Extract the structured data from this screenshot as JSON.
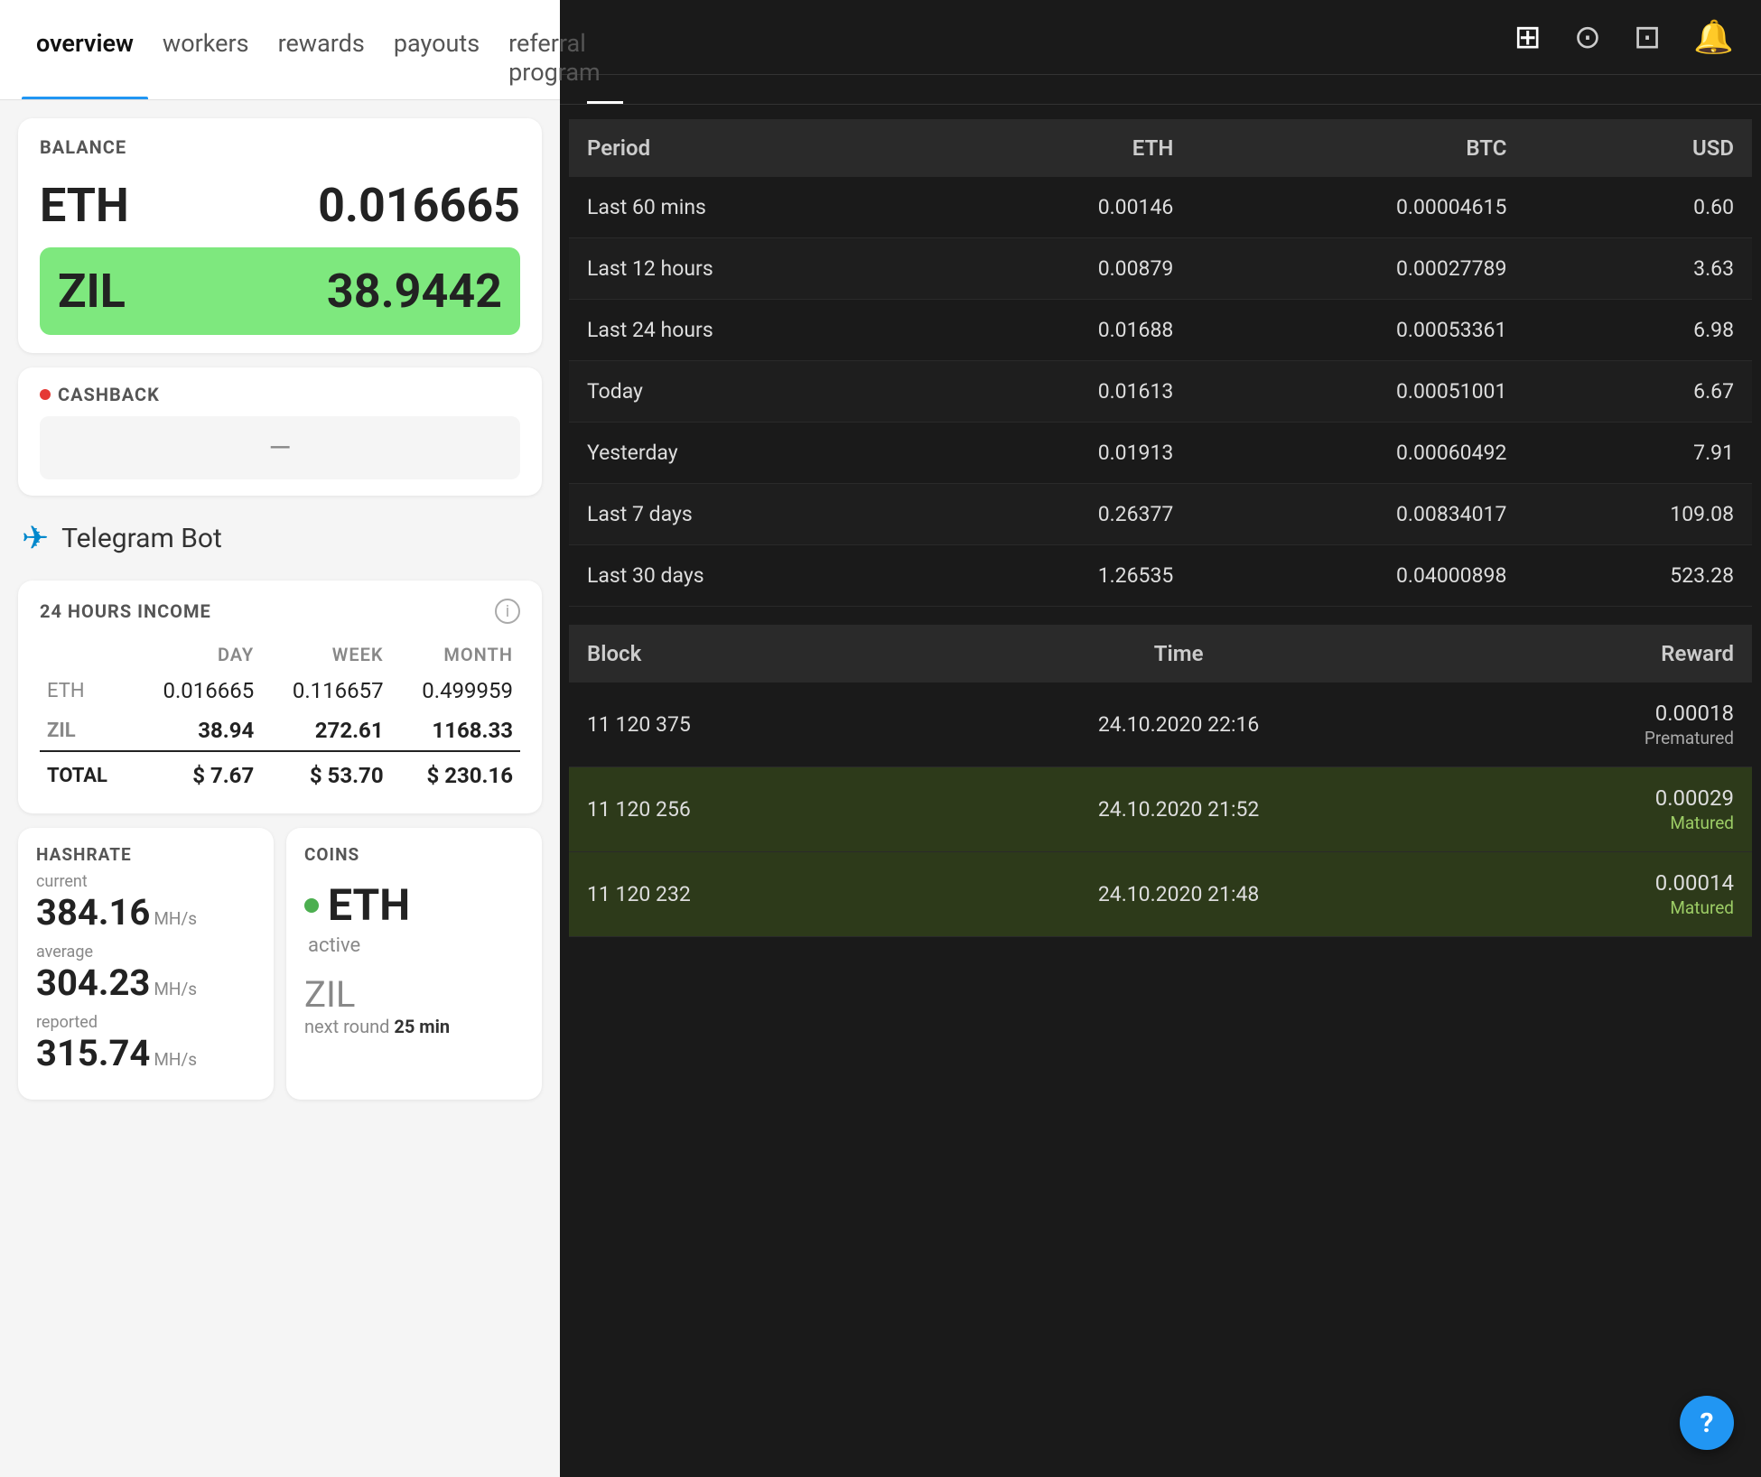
{
  "nav": {
    "items": [
      {
        "id": "overview",
        "label": "overview",
        "active": true
      },
      {
        "id": "workers",
        "label": "workers",
        "active": false
      },
      {
        "id": "rewards",
        "label": "rewards",
        "active": false
      },
      {
        "id": "payouts",
        "label": "payouts",
        "active": false
      },
      {
        "id": "referral",
        "label": "referral program",
        "active": false
      }
    ]
  },
  "balance": {
    "label": "BALANCE",
    "eth_coin": "ETH",
    "eth_value": "0.016665",
    "zil_coin": "ZIL",
    "zil_value": "38.9442"
  },
  "cashback": {
    "label": "CASHBACK",
    "value": "—"
  },
  "telegram": {
    "label": "Telegram Bot"
  },
  "income": {
    "title": "24 HOURS INCOME",
    "cols": [
      "",
      "DAY",
      "WEEK",
      "MONTH"
    ],
    "rows": [
      {
        "coin": "ETH",
        "day": "0.016665",
        "week": "0.116657",
        "month": "0.499959"
      },
      {
        "coin": "ZIL",
        "day": "38.94",
        "week": "272.61",
        "month": "1168.33"
      },
      {
        "coin": "TOTAL",
        "day": "$ 7.67",
        "week": "$ 53.70",
        "month": "$ 230.16"
      }
    ]
  },
  "hashrate": {
    "title": "HASHRATE",
    "current_label": "current",
    "current_value": "384.16",
    "current_unit": "MH/s",
    "average_label": "average",
    "average_value": "304.23",
    "average_unit": "MH/s",
    "reported_label": "reported",
    "reported_value": "315.74",
    "reported_unit": "MH/s"
  },
  "coins": {
    "title": "COINS",
    "eth_name": "ETH",
    "eth_status": "active",
    "eth_dot": "green",
    "zil_name": "ZIL",
    "zil_sub": "next round",
    "zil_time": "25 min"
  },
  "right_header": {
    "icons": [
      "layers",
      "circle-arrows",
      "folder",
      "bell"
    ]
  },
  "right_tabs": [
    {
      "label": "",
      "active": true
    }
  ],
  "earnings_table": {
    "headers": [
      "Period",
      "ETH",
      "BTC",
      "USD"
    ],
    "rows": [
      {
        "period": "Last 60 mins",
        "eth": "0.00146",
        "btc": "0.00004615",
        "usd": "0.60"
      },
      {
        "period": "Last 12 hours",
        "eth": "0.00879",
        "btc": "0.00027789",
        "usd": "3.63"
      },
      {
        "period": "Last 24 hours",
        "eth": "0.01688",
        "btc": "0.00053361",
        "usd": "6.98"
      },
      {
        "period": "Today",
        "eth": "0.01613",
        "btc": "0.00051001",
        "usd": "6.67"
      },
      {
        "period": "Yesterday",
        "eth": "0.01913",
        "btc": "0.00060492",
        "usd": "7.91"
      },
      {
        "period": "Last 7 days",
        "eth": "0.26377",
        "btc": "0.00834017",
        "usd": "109.08"
      },
      {
        "period": "Last 30 days",
        "eth": "1.26535",
        "btc": "0.04000898",
        "usd": "523.28"
      }
    ]
  },
  "blocks_table": {
    "headers": [
      "Block",
      "Time",
      "Reward"
    ],
    "rows": [
      {
        "block": "11 120 375",
        "time": "24.10.2020 22:16",
        "reward": "0.00018",
        "status": "Prematured",
        "matured": false
      },
      {
        "block": "11 120 256",
        "time": "24.10.2020 21:52",
        "reward": "0.00029",
        "status": "Matured",
        "matured": true
      },
      {
        "block": "11 120 232",
        "time": "24.10.2020 21:48",
        "reward": "0.00014",
        "status": "Matured",
        "matured": true
      }
    ]
  },
  "help": {
    "label": "?"
  }
}
